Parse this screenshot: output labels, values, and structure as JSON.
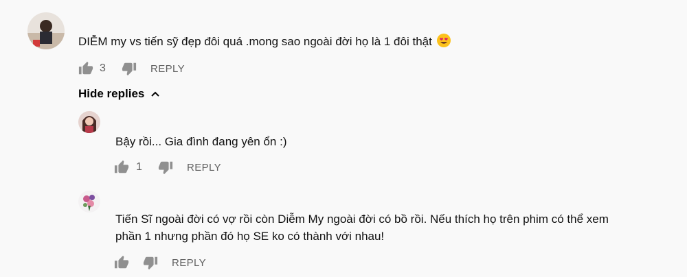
{
  "comments": [
    {
      "text": "DIỄM my vs tiến sỹ đẹp đôi quá .mong sao ngoài đời họ là 1 đôi thật",
      "emoji": "heart-eyes-emoji",
      "likes": "3",
      "reply_label": "REPLY"
    }
  ],
  "hide_replies_label": "Hide replies",
  "replies": [
    {
      "text": "Bậy rồi... Gia đình đang yên ổn :)",
      "likes": "1",
      "reply_label": "REPLY"
    },
    {
      "text_line1": "Tiến Sĩ ngoài đời có vợ rồi còn Diễm My ngoài đời có bồ rồi. Nếu thích họ trên phim có thể xem",
      "text_line2": "phần 1 nhưng phần đó họ SE ko có thành với nhau!",
      "likes": "",
      "reply_label": "REPLY"
    }
  ],
  "icons": {
    "like": "thumbs-up-icon",
    "dislike": "thumbs-down-icon",
    "collapse": "chevron-up-icon"
  },
  "colors": {
    "background": "#f9f9f9",
    "secondary_text": "#606060",
    "icon": "#909090"
  }
}
